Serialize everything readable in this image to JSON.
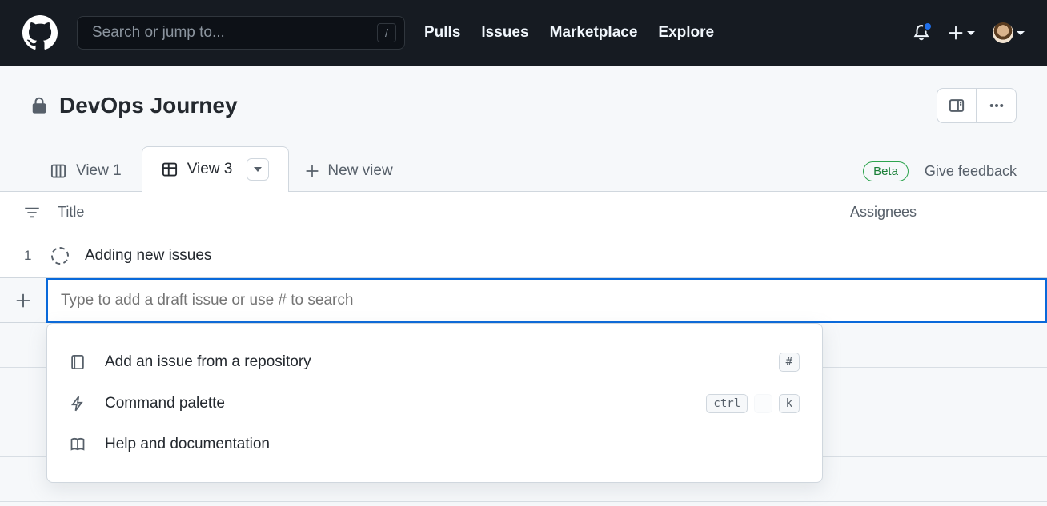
{
  "header": {
    "search_placeholder": "Search or jump to...",
    "search_key": "/",
    "nav": {
      "pulls": "Pulls",
      "issues": "Issues",
      "marketplace": "Marketplace",
      "explore": "Explore"
    }
  },
  "project": {
    "title": "DevOps Journey"
  },
  "tabs": {
    "items": [
      {
        "label": "View 1"
      },
      {
        "label": "View 3"
      }
    ],
    "new_view": "New view",
    "active_index": 1,
    "badge": "Beta",
    "feedback": "Give feedback"
  },
  "table": {
    "columns": {
      "title": "Title",
      "assignees": "Assignees"
    },
    "rows": [
      {
        "num": "1",
        "title": "Adding new issues"
      }
    ],
    "new_item_placeholder": "Type to add a draft issue or use # to search"
  },
  "dropdown": {
    "items": [
      {
        "label": "Add an issue from a repository",
        "key": "#"
      },
      {
        "label": "Command palette",
        "ctrl": "ctrl",
        "k": "k"
      },
      {
        "label": "Help and documentation"
      }
    ]
  }
}
